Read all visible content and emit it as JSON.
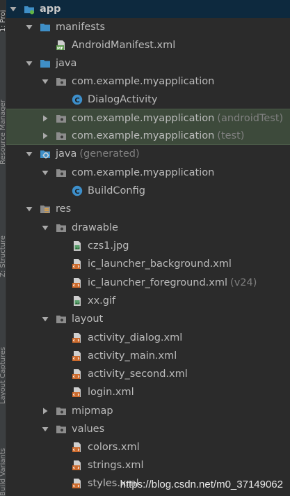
{
  "side_tabs": [
    "1: Proj",
    "Resource Manager",
    "Z: Structure",
    "Layout Captures",
    "Build Variants"
  ],
  "tree": [
    {
      "label": "app",
      "suffix": "",
      "icon": "module-icon",
      "arrow": "down",
      "bold": true
    },
    {
      "label": "manifests",
      "suffix": "",
      "icon": "folder-icon",
      "arrow": "down"
    },
    {
      "label": "AndroidManifest.xml",
      "suffix": "",
      "icon": "manifest-file-icon",
      "arrow": "none"
    },
    {
      "label": "java",
      "suffix": "",
      "icon": "folder-icon",
      "arrow": "down"
    },
    {
      "label": "com.example.myapplication",
      "suffix": "",
      "icon": "package-icon",
      "arrow": "down"
    },
    {
      "label": "DialogActivity",
      "suffix": "",
      "icon": "class-icon",
      "arrow": "none"
    },
    {
      "label": "com.example.myapplication",
      "suffix": "(androidTest)",
      "icon": "package-icon",
      "arrow": "right"
    },
    {
      "label": "com.example.myapplication",
      "suffix": "(test)",
      "icon": "package-icon",
      "arrow": "right"
    },
    {
      "label": "java",
      "suffix": "(generated)",
      "icon": "generated-folder-icon",
      "arrow": "down"
    },
    {
      "label": "com.example.myapplication",
      "suffix": "",
      "icon": "package-icon",
      "arrow": "down"
    },
    {
      "label": "BuildConfig",
      "suffix": "",
      "icon": "class-icon",
      "arrow": "none"
    },
    {
      "label": "res",
      "suffix": "",
      "icon": "resource-folder-icon",
      "arrow": "down"
    },
    {
      "label": "drawable",
      "suffix": "",
      "icon": "package-icon",
      "arrow": "down"
    },
    {
      "label": "czs1.jpg",
      "suffix": "",
      "icon": "image-file-icon",
      "arrow": "none"
    },
    {
      "label": "ic_launcher_background.xml",
      "suffix": "",
      "icon": "xml-file-icon",
      "arrow": "none"
    },
    {
      "label": "ic_launcher_foreground.xml",
      "suffix": "(v24)",
      "icon": "xml-file-icon",
      "arrow": "none"
    },
    {
      "label": "xx.gif",
      "suffix": "",
      "icon": "image-file-icon",
      "arrow": "none"
    },
    {
      "label": "layout",
      "suffix": "",
      "icon": "package-icon",
      "arrow": "down"
    },
    {
      "label": "activity_dialog.xml",
      "suffix": "",
      "icon": "xml-file-icon",
      "arrow": "none"
    },
    {
      "label": "activity_main.xml",
      "suffix": "",
      "icon": "xml-file-icon",
      "arrow": "none"
    },
    {
      "label": "activity_second.xml",
      "suffix": "",
      "icon": "xml-file-icon",
      "arrow": "none"
    },
    {
      "label": "login.xml",
      "suffix": "",
      "icon": "xml-file-icon",
      "arrow": "none"
    },
    {
      "label": "mipmap",
      "suffix": "",
      "icon": "package-icon",
      "arrow": "right"
    },
    {
      "label": "values",
      "suffix": "",
      "icon": "package-icon",
      "arrow": "down"
    },
    {
      "label": "colors.xml",
      "suffix": "",
      "icon": "xml-file-icon",
      "arrow": "none"
    },
    {
      "label": "strings.xml",
      "suffix": "",
      "icon": "xml-file-icon",
      "arrow": "none"
    },
    {
      "label": "styles.xml",
      "suffix": "",
      "icon": "xml-file-icon",
      "arrow": "none"
    }
  ],
  "watermark": "https://blog.csdn.net/m0_37149062",
  "colors": {
    "background": "#2b2b2b",
    "highlight_rows": "#3d4a3b",
    "folder_blue": "#3f8fc7",
    "class_badge": "#3d8fcb",
    "xml_badge": "#cc6a2c",
    "manifest_badge": "#5d9a4c",
    "suffix_gray": "#808080"
  }
}
